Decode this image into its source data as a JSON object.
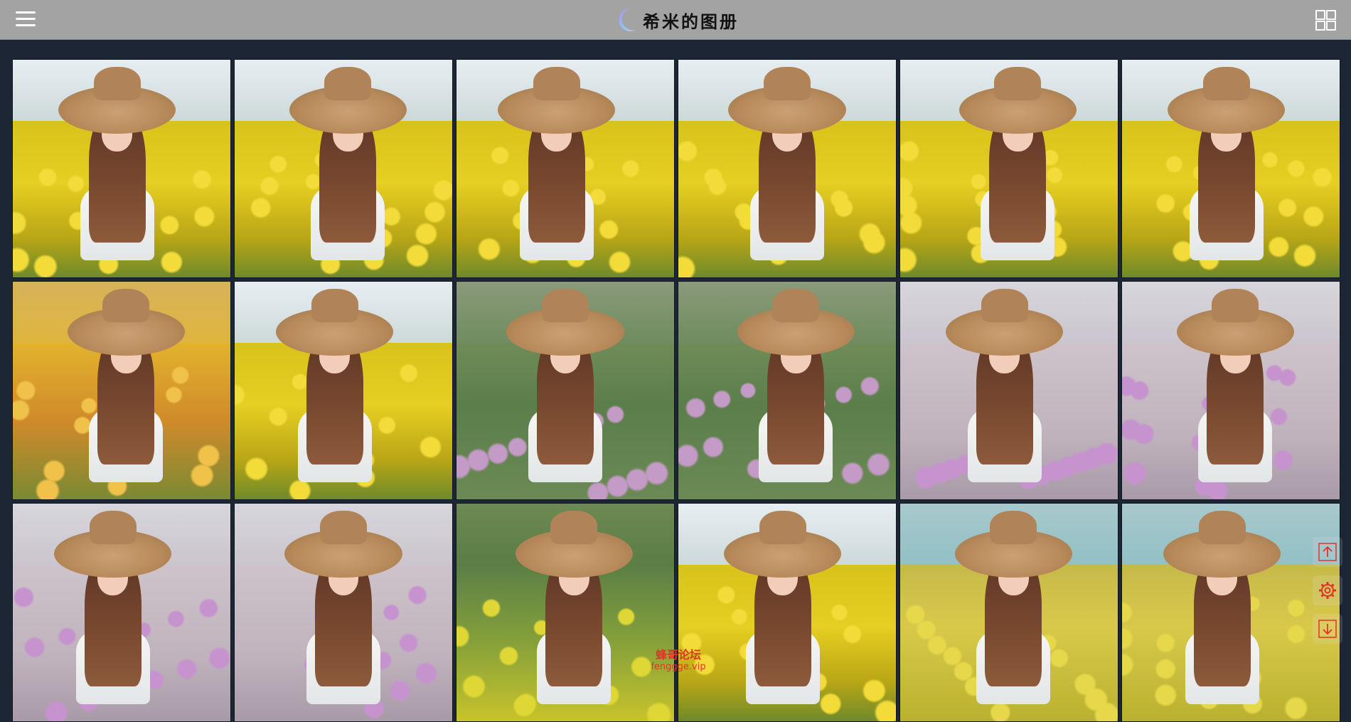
{
  "header": {
    "title": "希米的图册",
    "menu_icon": "hamburger-menu-icon",
    "logo_icon": "crescent-moon-icon",
    "layout_icon": "grid-view-icon"
  },
  "colors": {
    "header_bg": "#a3a3a3",
    "page_bg": "#1c2634",
    "accent": "#e1352a"
  },
  "gallery": {
    "photos": [
      {
        "scene": "yellow",
        "subject": "profile-hat"
      },
      {
        "scene": "yellow",
        "subject": "hat-looking-down"
      },
      {
        "scene": "yellow",
        "subject": "standing-white-dress"
      },
      {
        "scene": "yellow",
        "subject": "hat-side-pose"
      },
      {
        "scene": "yellow",
        "subject": "hat-closeup-smile"
      },
      {
        "scene": "yellow",
        "subject": "hat-over-shoulder"
      },
      {
        "scene": "orange",
        "subject": "hat-hands-clasped"
      },
      {
        "scene": "yellow",
        "subject": "white-dress-closeup"
      },
      {
        "scene": "pink",
        "subject": "standing-in-pink-flowers"
      },
      {
        "scene": "pink",
        "subject": "standing-in-pink-flowers"
      },
      {
        "scene": "pinkgrey",
        "subject": "closeup-with-pink-flower"
      },
      {
        "scene": "pinkgrey",
        "subject": "closeup-with-pink-flower"
      },
      {
        "scene": "pinkgrey",
        "subject": "hat-portrait-pink-flower"
      },
      {
        "scene": "pinkgrey",
        "subject": "hat-portrait-pink-flower"
      },
      {
        "scene": "green",
        "subject": "arms-raised-white-sleeves"
      },
      {
        "scene": "yellow",
        "subject": "hat-portrait-yellow"
      },
      {
        "scene": "teal",
        "subject": "hat-distant-field"
      },
      {
        "scene": "teal",
        "subject": "hat-distant-field"
      }
    ]
  },
  "side_tools": {
    "scroll_top_icon": "arrow-up-icon",
    "settings_icon": "gear-icon",
    "scroll_bottom_icon": "arrow-down-icon"
  },
  "watermark": {
    "line1": "蜂哥论坛",
    "line2": "fenggge.vip"
  }
}
